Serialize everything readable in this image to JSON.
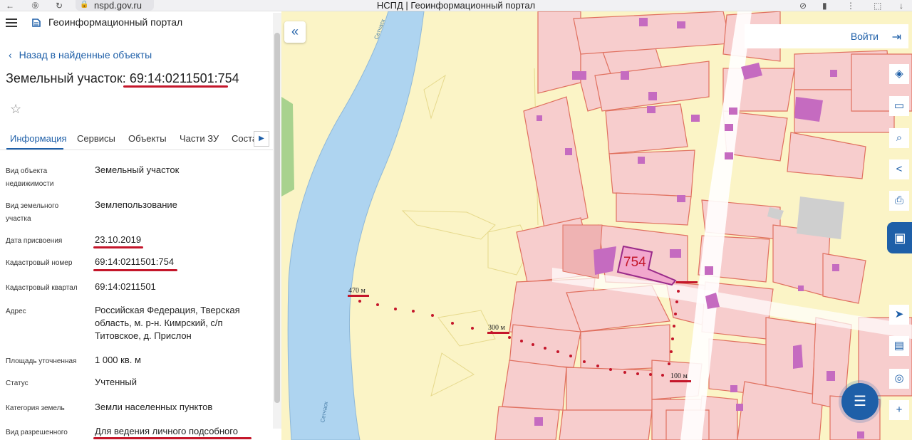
{
  "browser": {
    "url": "nspd.gov.ru",
    "tab_title": "НСПД | Геоинформационный портал"
  },
  "header": {
    "title": "Геоинформационный портал"
  },
  "back_link": "Назад в найденные объекты",
  "object": {
    "title_prefix": "Земельный участок: ",
    "cadastral_number": "69:14:0211501:754"
  },
  "tabs": [
    "Информация",
    "Сервисы",
    "Объекты",
    "Части ЗУ",
    "Соста"
  ],
  "info": [
    {
      "label": "Вид объекта недвижимости",
      "value": "Земельный участок"
    },
    {
      "label": "Вид земельного участка",
      "value": "Землепользование"
    },
    {
      "label": "Дата присвоения",
      "value": "23.10.2019"
    },
    {
      "label": "Кадастровый номер",
      "value": "69:14:0211501:754"
    },
    {
      "label": "Кадастровый квартал",
      "value": "69:14:0211501"
    },
    {
      "label": "Адрес",
      "value": "Российская Федерация, Тверская область, м. р-н. Кимрский, с/п Титовское, д. Прислон"
    },
    {
      "label": "Площадь уточненная",
      "value": "1 000 кв. м"
    },
    {
      "label": "Статус",
      "value": "Учтенный"
    },
    {
      "label": "Категория земель",
      "value": "Земли населенных пунктов"
    },
    {
      "label": "Вид разрешенного",
      "value": "Для ведения личного подсобного"
    }
  ],
  "map": {
    "login_label": "Войти",
    "parcel_label": "754",
    "distance_labels": [
      "470 м",
      "300 м",
      "100 м"
    ],
    "river_label": "Сетчаск"
  },
  "colors": {
    "accent": "#1e5fa8",
    "highlight": "#c4162a",
    "parcel_fill": "#f7cdcd",
    "parcel_stroke": "#e0705f",
    "meadow": "#fbf4c6",
    "river": "#aed4f0",
    "building": "#c56bc0"
  },
  "icons": [
    "menu-icon",
    "logo-icon",
    "chevron-left-icon",
    "star-icon",
    "double-chevron-left-icon",
    "login-icon",
    "layers-icon",
    "ruler-icon",
    "search-area-icon",
    "share-icon",
    "print-icon",
    "legend-icon",
    "navigate-icon",
    "screen-icon",
    "location-icon",
    "zoom-in-icon",
    "chat-icon"
  ]
}
